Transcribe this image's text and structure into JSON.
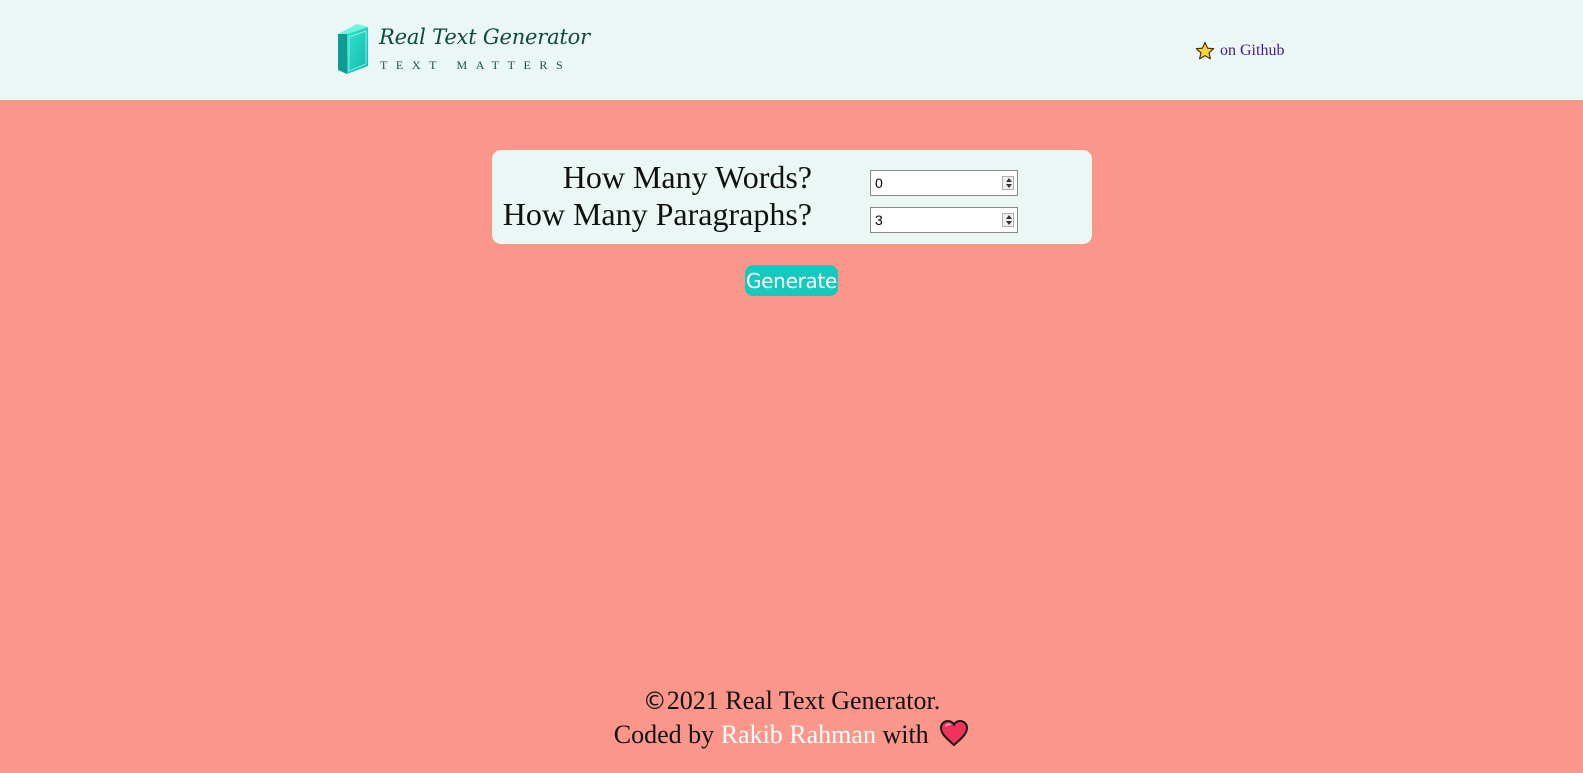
{
  "header": {
    "logo": {
      "title": "Real Text Generator",
      "tagline": "TEXT MATTERS"
    },
    "github_link": {
      "icon": "star-icon",
      "label": "on Github",
      "color": "#4b1a8a"
    }
  },
  "form": {
    "words": {
      "label": "How Many Words?",
      "value": "0"
    },
    "paragraphs": {
      "label": "How Many Paragraphs?",
      "value": "3"
    }
  },
  "generate_button": {
    "label": "Generate"
  },
  "footer": {
    "copyright_symbol": "©",
    "copyright_text": "2021 Real Text Generator.",
    "coded_by_prefix": "Coded by",
    "author": "Rakib Rahman",
    "coded_by_suffix": "with",
    "heart_icon": "heart-icon"
  },
  "colors": {
    "background": "#fa968a",
    "header_bg": "#eaf7f4",
    "card_bg": "#eaf7f4",
    "accent": "#16c8bd",
    "link": "#4b1a8a"
  }
}
